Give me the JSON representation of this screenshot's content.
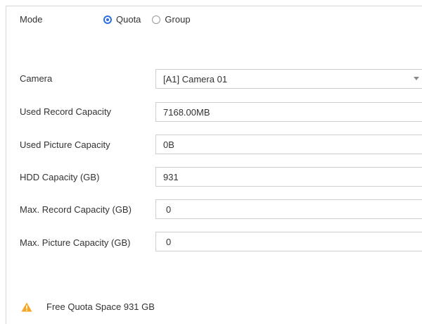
{
  "mode": {
    "label": "Mode",
    "options": [
      {
        "label": "Quota",
        "checked": true
      },
      {
        "label": "Group",
        "checked": false
      }
    ]
  },
  "camera": {
    "label": "Camera",
    "value": "[A1] Camera 01"
  },
  "used_record": {
    "label": "Used Record Capacity",
    "value": "7168.00MB"
  },
  "used_picture": {
    "label": "Used Picture Capacity",
    "value": "0B"
  },
  "hdd_capacity": {
    "label": "HDD Capacity (GB)",
    "value": "931"
  },
  "max_record": {
    "label": "Max. Record Capacity (GB)",
    "value": "0"
  },
  "max_picture": {
    "label": "Max. Picture Capacity (GB)",
    "value": "0"
  },
  "notice": {
    "text": "Free Quota Space 931 GB",
    "icon": "warning-icon",
    "icon_color": "#f5a623"
  },
  "colors": {
    "accent": "#2f6fe0",
    "border": "#cfcfcf"
  }
}
